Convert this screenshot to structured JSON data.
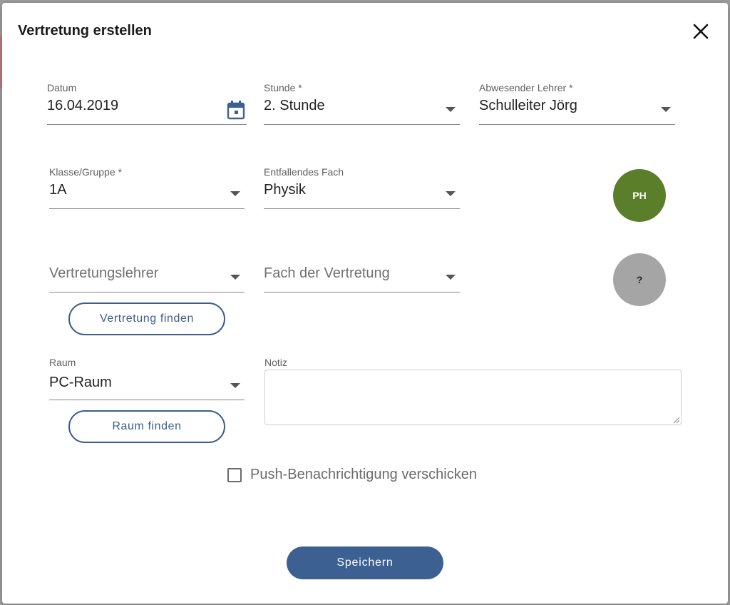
{
  "dialog": {
    "title": "Vertretung erstellen",
    "close_icon": "close-icon"
  },
  "fields": {
    "datum": {
      "label": "Datum",
      "value": "16.04.2019",
      "icon": "calendar-icon"
    },
    "stunde": {
      "label": "Stunde *",
      "value": "2. Stunde"
    },
    "abwesender_lehrer": {
      "label": "Abwesender Lehrer *",
      "value": "Schulleiter Jörg"
    },
    "klasse": {
      "label": "Klasse/Gruppe *",
      "value": "1A"
    },
    "entfallendes_fach": {
      "label": "Entfallendes Fach",
      "value": "Physik"
    },
    "vertretungslehrer": {
      "placeholder": "Vertretungslehrer"
    },
    "fach_vertretung": {
      "placeholder": "Fach der Vertretung"
    },
    "raum": {
      "label": "Raum",
      "value": "PC-Raum"
    },
    "notiz": {
      "label": "Notiz",
      "value": ""
    }
  },
  "badges": {
    "entfallendes_fach": {
      "text": "PH",
      "color": "#5a7e2a"
    },
    "vertretung_fach": {
      "text": "?",
      "color": "#a5a5a5"
    }
  },
  "buttons": {
    "vertretung_finden": "Vertretung finden",
    "raum_finden": "Raum finden",
    "speichern": "Speichern"
  },
  "push_checkbox": {
    "label": "Push-Benachrichtigung verschicken",
    "checked": false
  },
  "colors": {
    "primary": "#3c6092",
    "outline": "#3c5d8c"
  }
}
